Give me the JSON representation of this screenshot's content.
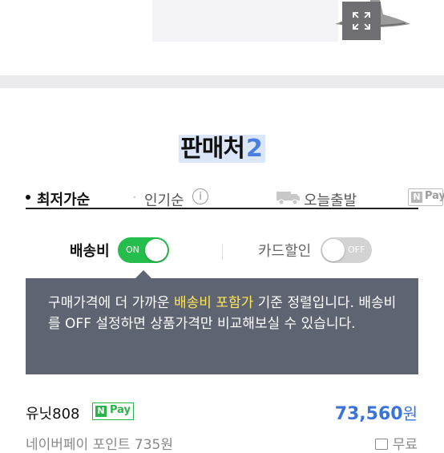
{
  "sellers": {
    "title": "판매처",
    "count": "2"
  },
  "sort": {
    "lowest": "최저가순",
    "separator": "·",
    "popular": "인기순",
    "info_glyph": "i",
    "today_delivery": "오늘출발",
    "npay_n": "N",
    "npay_pay": "Pay"
  },
  "filters": {
    "shipping_label": "배송비",
    "shipping_toggle": "ON",
    "card_label": "카드할인",
    "card_toggle": "OFF"
  },
  "tooltip": {
    "text_before": "구매가격에 더 가까운 ",
    "highlight": "배송비 포함가",
    "text_after": " 기준 정렬입니다. 배송비를 OFF 설정하면 상품가격만 비교해보실 수 있습니다."
  },
  "listing": {
    "seller_name": "유닛808",
    "npay_n": "N",
    "npay_pay": "Pay",
    "price": "73,560",
    "currency": "원",
    "points": "네이버페이 포인트 735원",
    "shipping": "무료"
  },
  "colors": {
    "accent_blue": "#4a7fe0",
    "toggle_green": "#25bd4b",
    "tooltip_bg": "#5f6473",
    "tooltip_highlight": "#ffe55a",
    "npay_green": "#29b34a"
  },
  "icons": [
    "expand-icon",
    "info-icon",
    "truck-icon",
    "npay-icon",
    "shipping-icon"
  ]
}
